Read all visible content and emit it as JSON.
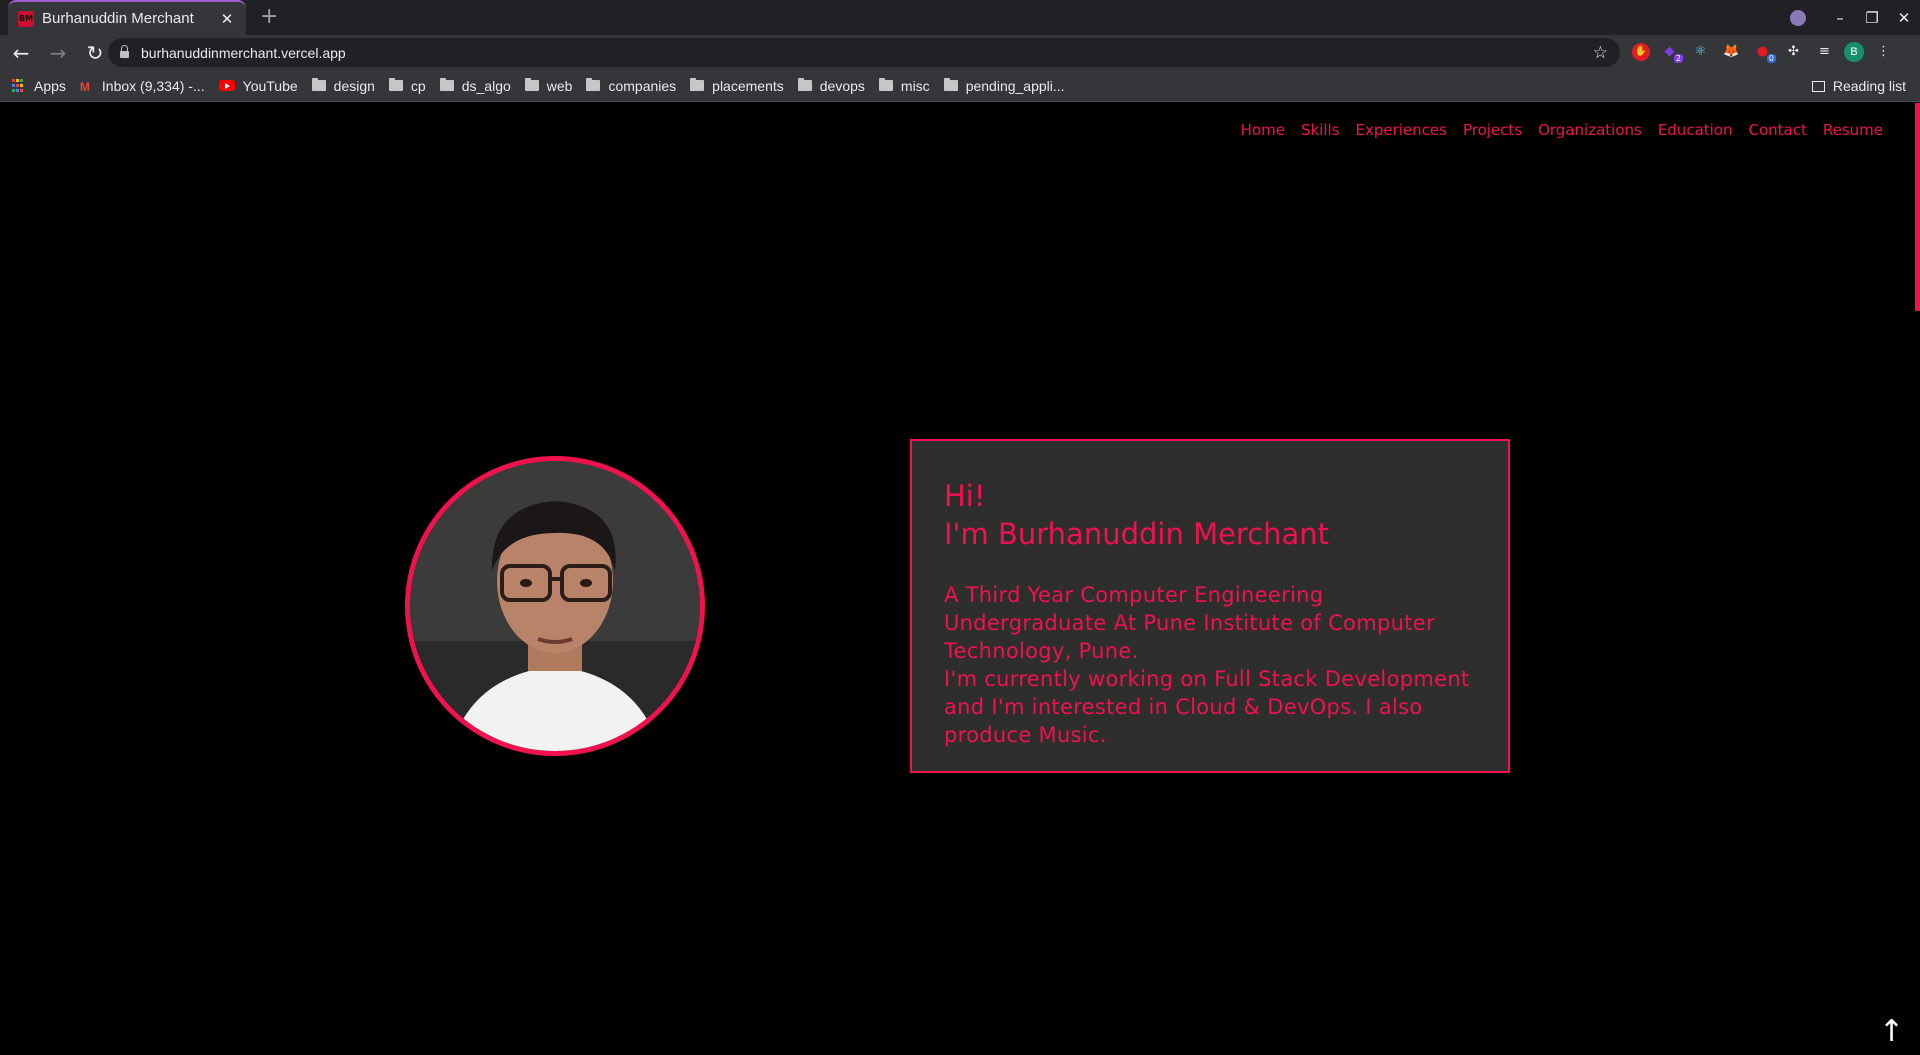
{
  "browser": {
    "tab_title": "Burhanuddin Merchant",
    "tab_favicon_text": "BM",
    "tab_close": "✕",
    "new_tab": "+",
    "url": "burhanuddinmerchant.vercel.app",
    "profile_initial": "B",
    "bookmarks": [
      {
        "label": "Apps",
        "icon": "apps-grid-icon"
      },
      {
        "label": "Inbox (9,334) -...",
        "icon": "gmail-icon"
      },
      {
        "label": "YouTube",
        "icon": "youtube-icon"
      },
      {
        "label": "design",
        "icon": "folder-icon"
      },
      {
        "label": "cp",
        "icon": "folder-icon"
      },
      {
        "label": "ds_algo",
        "icon": "folder-icon"
      },
      {
        "label": "web",
        "icon": "folder-icon"
      },
      {
        "label": "companies",
        "icon": "folder-icon"
      },
      {
        "label": "placements",
        "icon": "folder-icon"
      },
      {
        "label": "devops",
        "icon": "folder-icon"
      },
      {
        "label": "misc",
        "icon": "folder-icon"
      },
      {
        "label": "pending_appli...",
        "icon": "folder-icon"
      }
    ],
    "reading_list": "Reading list",
    "extension_badges": [
      "2",
      "0"
    ]
  },
  "site": {
    "nav": [
      "Home",
      "Skills",
      "Experiences",
      "Projects",
      "Organizations",
      "Education",
      "Contact",
      "Resume"
    ],
    "greeting_line1": "Hi!",
    "greeting_line2": "I'm Burhanuddin Merchant",
    "description_line1": "A Third Year Computer Engineering Undergraduate At Pune Institute of Computer Technology, Pune.",
    "description_line2": "I'm currently working on Full Stack Development and I'm interested in Cloud & DevOps. I also produce Music.",
    "back_to_top": "↑"
  },
  "colors": {
    "accent": "#f0124d",
    "card_bg": "#2e2e2e",
    "page_bg": "#000000"
  }
}
